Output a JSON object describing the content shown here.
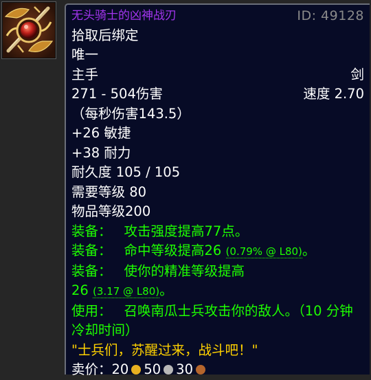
{
  "item": {
    "icon": "ornate-sword-emblem-icon",
    "name": "无头骑士的凶神战刃",
    "id_label": "ID: 49128",
    "bind": "拾取后绑定",
    "unique": "唯一",
    "slot": "主手",
    "type": "剑",
    "damage": "271 - 504伤害",
    "speed": "速度 2.70",
    "dps": "（每秒伤害143.5）",
    "stats": [
      "+26 敏捷",
      "+38 耐力"
    ],
    "durability": "耐久度 105 / 105",
    "required_level": "需要等级 80",
    "item_level": "物品等级200",
    "effects": [
      {
        "prefix": "装备：",
        "text": "攻击强度提高77点。"
      },
      {
        "prefix": "装备：",
        "text": "命中等级提高26",
        "extra": "(0.79% @ L80)",
        "end": "。"
      },
      {
        "prefix": "装备：",
        "text": "使你的精准等级提高",
        "line2": "26",
        "extra": "(3.17 @ L80)",
        "end": "。"
      }
    ],
    "use": {
      "prefix": "使用：",
      "text": "召唤南瓜士兵攻击你的敌人。（10 分钟冷却时间）"
    },
    "flavor": "\"士兵们，苏醒过来，战斗吧！\"",
    "sell_label": "卖价：20",
    "sell_silver": "50",
    "sell_copper": "30"
  },
  "colors": {
    "epic": "#a335ee",
    "effect": "#1eff00",
    "flavor": "#ffd100",
    "background": "#070b26"
  }
}
